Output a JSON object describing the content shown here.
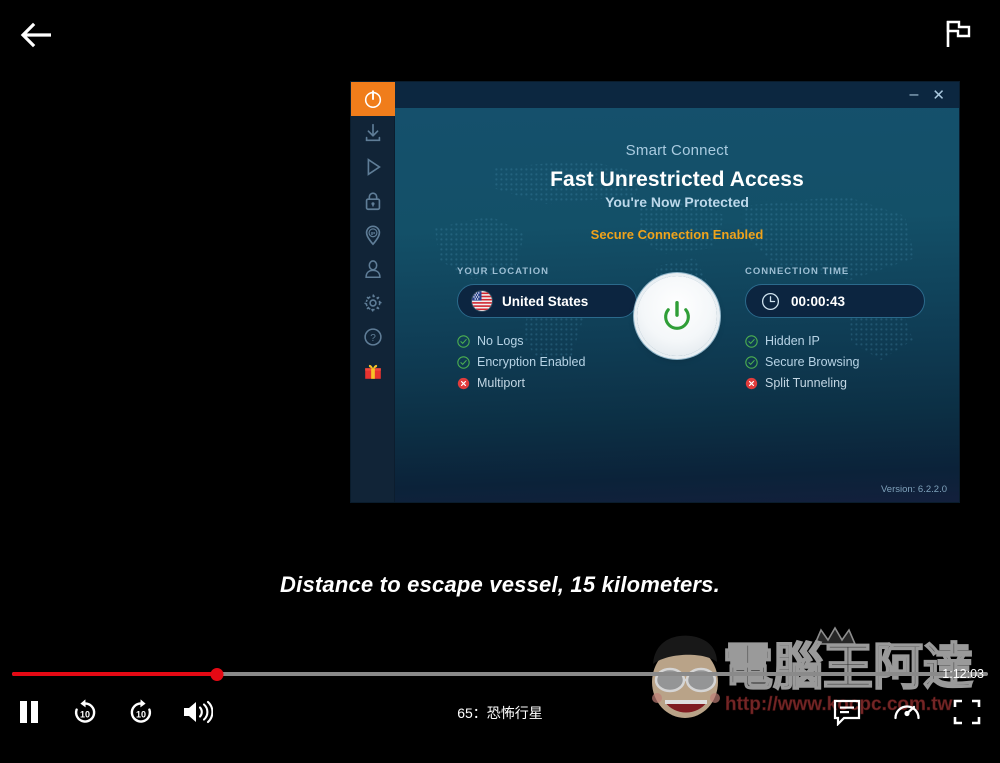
{
  "player": {
    "back_icon": "arrow-left-icon",
    "flag_icon": "flag-icon",
    "subtitle_text": "Distance to escape vessel, 15 kilometers.",
    "title": "65：恐怖行星",
    "time_remaining": "1:12:03",
    "progress_percent": 21,
    "controls": {
      "pause": "pause-icon",
      "rewind_10": "replay-10-icon",
      "rewind_10_label": "10",
      "forward_10": "forward-10-icon",
      "forward_10_label": "10",
      "volume": "volume-high-icon",
      "subtitles": "subtitles-icon",
      "speed": "playback-speed-icon",
      "fullscreen": "fullscreen-icon"
    },
    "colors": {
      "progress_played": "#e50914",
      "progress_track": "#8a8a8a",
      "background": "#000000"
    }
  },
  "watermark": {
    "brand": "電腦王阿達",
    "url": "http://www.kocpc.com.tw"
  },
  "vpn": {
    "titlebar": {
      "minimize_label": "–",
      "close_label": "✕"
    },
    "sidebar": [
      {
        "name": "power",
        "icon": "power-icon",
        "active": true
      },
      {
        "name": "download",
        "icon": "download-icon",
        "active": false
      },
      {
        "name": "streaming",
        "icon": "play-icon",
        "active": false
      },
      {
        "name": "security",
        "icon": "lock-icon",
        "active": false
      },
      {
        "name": "ip-location",
        "icon": "ip-pin-icon",
        "active": false
      },
      {
        "name": "account",
        "icon": "user-icon",
        "active": false
      },
      {
        "name": "settings",
        "icon": "gear-icon",
        "active": false
      },
      {
        "name": "help",
        "icon": "help-circle-icon",
        "active": false
      },
      {
        "name": "rewards",
        "icon": "gift-icon",
        "active": false
      }
    ],
    "smart_connect": "Smart Connect",
    "headline": "Fast Unrestricted Access",
    "subheadline": "You're Now Protected",
    "secure_status": "Secure Connection Enabled",
    "location": {
      "label": "YOUR LOCATION",
      "value": "United States",
      "flag_icon": "flag-us-icon"
    },
    "connection_time": {
      "label": "CONNECTION TIME",
      "value": "00:00:43",
      "icon": "clock-icon"
    },
    "features_left": [
      {
        "label": "No Logs",
        "state": "on"
      },
      {
        "label": "Encryption Enabled",
        "state": "on"
      },
      {
        "label": "Multiport",
        "state": "off"
      }
    ],
    "features_right": [
      {
        "label": "Hidden IP",
        "state": "on"
      },
      {
        "label": "Secure Browsing",
        "state": "on"
      },
      {
        "label": "Split Tunneling",
        "state": "off"
      }
    ],
    "power_button": {
      "icon": "power-icon",
      "state": "connected"
    },
    "version": "Version: 6.2.2.0",
    "colors": {
      "accent_orange": "#f07d1b",
      "status_orange": "#f0a31b",
      "on_green": "#4caf50",
      "off_red": "#e03c3c",
      "panel_top": "#15506c",
      "panel_bottom": "#13203c"
    }
  }
}
